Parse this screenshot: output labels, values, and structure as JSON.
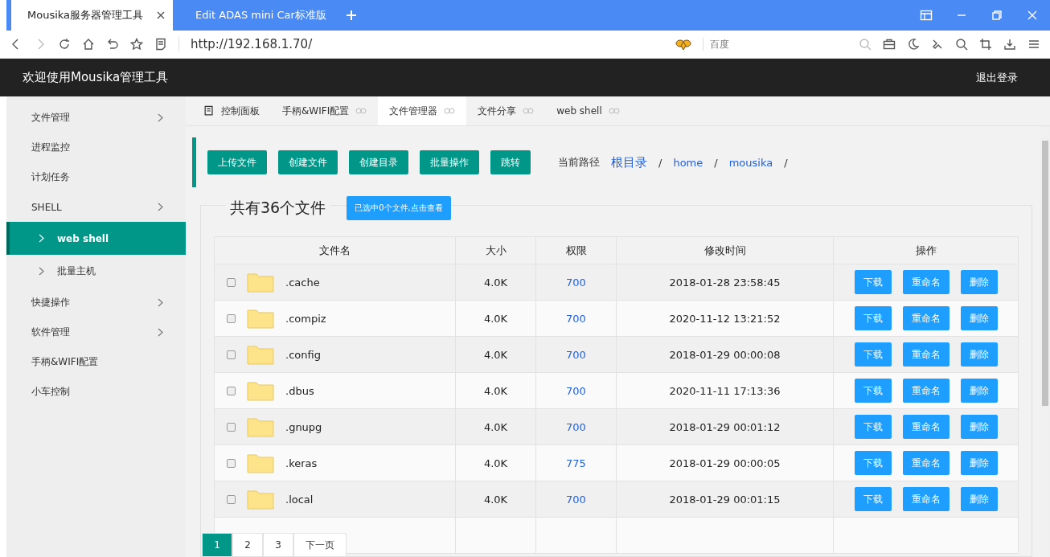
{
  "browser": {
    "tabs": [
      {
        "title": "Mousika服务器管理工具",
        "selected": true
      },
      {
        "title": "Edit ADAS mini Car标准版",
        "selected": false
      }
    ],
    "url": "http://192.168.1.70/",
    "search": {
      "placeholder": "百度"
    }
  },
  "header": {
    "title": "欢迎使用Mousika管理工具",
    "logout": "退出登录"
  },
  "sidebar": {
    "items": [
      {
        "label": "文件管理",
        "expandable": true,
        "selected": false
      },
      {
        "label": "进程监控",
        "expandable": false,
        "selected": false
      },
      {
        "label": "计划任务",
        "expandable": false,
        "selected": false
      },
      {
        "label": "SHELL",
        "expandable": true,
        "selected": false,
        "children": [
          {
            "label": "web shell",
            "selected": true
          },
          {
            "label": "批量主机",
            "selected": false
          }
        ]
      },
      {
        "label": "快捷操作",
        "expandable": true,
        "selected": false
      },
      {
        "label": "软件管理",
        "expandable": true,
        "selected": false
      },
      {
        "label": "手柄&WIFI配置",
        "expandable": false,
        "selected": false
      },
      {
        "label": "小车控制",
        "expandable": false,
        "selected": false
      }
    ]
  },
  "page_tabs": [
    {
      "label": "控制面板",
      "kind": "home",
      "selected": false
    },
    {
      "label": "手柄&WIFI配置",
      "kind": "closable",
      "selected": false
    },
    {
      "label": "文件管理器",
      "kind": "closable",
      "selected": true
    },
    {
      "label": "文件分享",
      "kind": "closable",
      "selected": false
    },
    {
      "label": "web shell",
      "kind": "closable",
      "selected": false
    }
  ],
  "toolbar": {
    "buttons": [
      "上传文件",
      "创建文件",
      "创建目录",
      "批量操作",
      "跳转"
    ],
    "path_label": "当前路径",
    "breadcrumb": [
      {
        "label": "根目录",
        "separator": "/"
      },
      {
        "label": "home",
        "separator": "/"
      },
      {
        "label": "mousika",
        "separator": "/"
      }
    ]
  },
  "summary": {
    "title": "共有36个文件",
    "selection_button": "已选中0个文件,点击查看"
  },
  "table": {
    "columns": [
      "文件名",
      "大小",
      "权限",
      "修改时间",
      "操作"
    ],
    "rows": [
      {
        "checked": false,
        "name": ".cache",
        "size": "4.0K",
        "perm": "700",
        "mtime": "2018-01-28 23:58:45",
        "actions": [
          "下载",
          "重命名",
          "删除"
        ]
      },
      {
        "checked": false,
        "name": ".compiz",
        "size": "4.0K",
        "perm": "700",
        "mtime": "2020-11-12 13:21:52",
        "actions": [
          "下载",
          "重命名",
          "删除"
        ]
      },
      {
        "checked": false,
        "name": ".config",
        "size": "4.0K",
        "perm": "700",
        "mtime": "2018-01-29 00:00:08",
        "actions": [
          "下载",
          "重命名",
          "删除"
        ]
      },
      {
        "checked": false,
        "name": ".dbus",
        "size": "4.0K",
        "perm": "700",
        "mtime": "2020-11-11 17:13:36",
        "actions": [
          "下载",
          "重命名",
          "删除"
        ]
      },
      {
        "checked": false,
        "name": ".gnupg",
        "size": "4.0K",
        "perm": "700",
        "mtime": "2018-01-29 00:01:12",
        "actions": [
          "下载",
          "重命名",
          "删除"
        ]
      },
      {
        "checked": false,
        "name": ".keras",
        "size": "4.0K",
        "perm": "775",
        "mtime": "2018-01-29 00:00:05",
        "actions": [
          "下载",
          "重命名",
          "删除"
        ]
      },
      {
        "checked": false,
        "name": ".local",
        "size": "4.0K",
        "perm": "700",
        "mtime": "2018-01-29 00:01:15",
        "actions": [
          "下载",
          "重命名",
          "删除"
        ]
      }
    ]
  },
  "pagination": [
    {
      "label": "1",
      "selected": true
    },
    {
      "label": "2",
      "selected": false
    },
    {
      "label": "3",
      "selected": false
    },
    {
      "label": "下一页",
      "selected": false
    }
  ]
}
